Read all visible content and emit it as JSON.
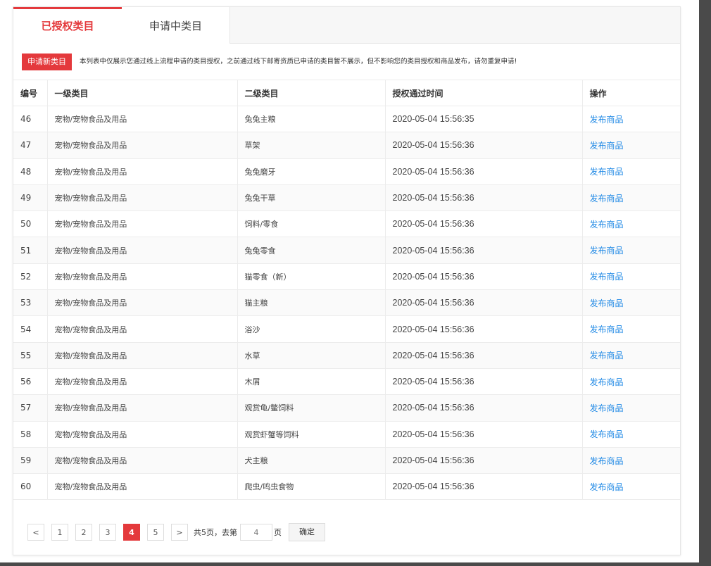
{
  "tabs": [
    {
      "label": "已授权类目",
      "active": true
    },
    {
      "label": "申请中类目",
      "active": false
    }
  ],
  "notice": {
    "button": "申请新类目",
    "text": "本列表中仅展示您通过线上流程申请的类目授权，之前通过线下邮寄资质已申请的类目暂不展示，但不影响您的类目授权和商品发布，请勿重复申请!"
  },
  "table": {
    "headers": [
      "编号",
      "一级类目",
      "二级类目",
      "授权通过时间",
      "操作"
    ],
    "rows": [
      {
        "id": "46",
        "cat1": "宠物/宠物食品及用品",
        "cat2": "兔兔主粮",
        "time": "2020-05-04 15:56:35",
        "op": "发布商品"
      },
      {
        "id": "47",
        "cat1": "宠物/宠物食品及用品",
        "cat2": "草架",
        "time": "2020-05-04 15:56:36",
        "op": "发布商品"
      },
      {
        "id": "48",
        "cat1": "宠物/宠物食品及用品",
        "cat2": "兔兔磨牙",
        "time": "2020-05-04 15:56:36",
        "op": "发布商品"
      },
      {
        "id": "49",
        "cat1": "宠物/宠物食品及用品",
        "cat2": "兔兔干草",
        "time": "2020-05-04 15:56:36",
        "op": "发布商品"
      },
      {
        "id": "50",
        "cat1": "宠物/宠物食品及用品",
        "cat2": "饲料/零食",
        "time": "2020-05-04 15:56:36",
        "op": "发布商品"
      },
      {
        "id": "51",
        "cat1": "宠物/宠物食品及用品",
        "cat2": "兔兔零食",
        "time": "2020-05-04 15:56:36",
        "op": "发布商品"
      },
      {
        "id": "52",
        "cat1": "宠物/宠物食品及用品",
        "cat2": "猫零食（新）",
        "time": "2020-05-04 15:56:36",
        "op": "发布商品"
      },
      {
        "id": "53",
        "cat1": "宠物/宠物食品及用品",
        "cat2": "猫主粮",
        "time": "2020-05-04 15:56:36",
        "op": "发布商品"
      },
      {
        "id": "54",
        "cat1": "宠物/宠物食品及用品",
        "cat2": "浴沙",
        "time": "2020-05-04 15:56:36",
        "op": "发布商品"
      },
      {
        "id": "55",
        "cat1": "宠物/宠物食品及用品",
        "cat2": "水草",
        "time": "2020-05-04 15:56:36",
        "op": "发布商品"
      },
      {
        "id": "56",
        "cat1": "宠物/宠物食品及用品",
        "cat2": "木屑",
        "time": "2020-05-04 15:56:36",
        "op": "发布商品"
      },
      {
        "id": "57",
        "cat1": "宠物/宠物食品及用品",
        "cat2": "观赏龟/鳖饲料",
        "time": "2020-05-04 15:56:36",
        "op": "发布商品"
      },
      {
        "id": "58",
        "cat1": "宠物/宠物食品及用品",
        "cat2": "观赏虾蟹等饲料",
        "time": "2020-05-04 15:56:36",
        "op": "发布商品"
      },
      {
        "id": "59",
        "cat1": "宠物/宠物食品及用品",
        "cat2": "犬主粮",
        "time": "2020-05-04 15:56:36",
        "op": "发布商品"
      },
      {
        "id": "60",
        "cat1": "宠物/宠物食品及用品",
        "cat2": "爬虫/鸣虫食物",
        "time": "2020-05-04 15:56:36",
        "op": "发布商品"
      }
    ]
  },
  "pager": {
    "prev": "<",
    "next": ">",
    "pages": [
      "1",
      "2",
      "3",
      "4",
      "5"
    ],
    "current": "4",
    "total_text": "共5页，去第",
    "input_value": "4",
    "page_unit": "页",
    "confirm": "确定"
  },
  "colors": {
    "accent": "#e4393c",
    "link": "#1e88e5"
  }
}
